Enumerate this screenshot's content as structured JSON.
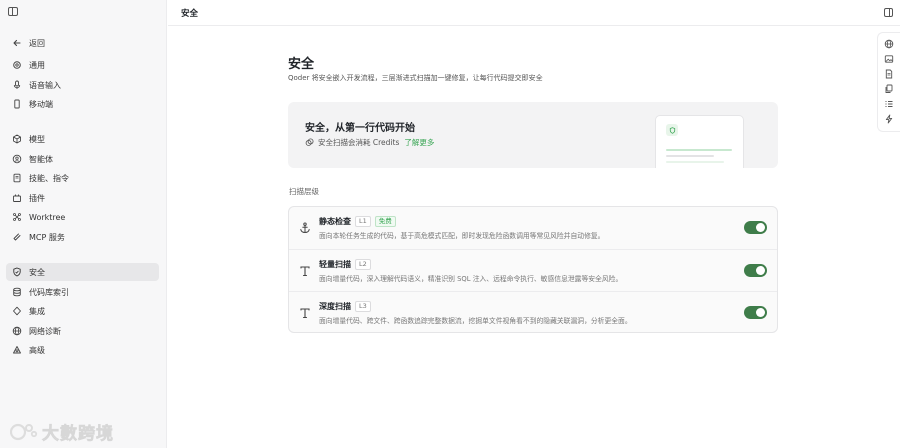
{
  "sidebar": {
    "back": "返回",
    "items": [
      {
        "label": "通用",
        "icon": "gear-icon"
      },
      {
        "label": "语音输入",
        "icon": "microphone-icon"
      },
      {
        "label": "移动端",
        "icon": "mobile-icon"
      },
      {
        "label": "模型",
        "icon": "cube-icon"
      },
      {
        "label": "智能体",
        "icon": "agent-icon"
      },
      {
        "label": "技能、指令",
        "icon": "book-icon"
      },
      {
        "label": "插件",
        "icon": "plugin-icon"
      },
      {
        "label": "Worktree",
        "icon": "branch-icon"
      },
      {
        "label": "MCP 服务",
        "icon": "mcp-icon"
      },
      {
        "label": "安全",
        "icon": "shield-icon",
        "active": true
      },
      {
        "label": "代码库索引",
        "icon": "database-icon"
      },
      {
        "label": "集成",
        "icon": "integration-icon"
      },
      {
        "label": "网络诊断",
        "icon": "globe-icon"
      },
      {
        "label": "高级",
        "icon": "advanced-icon"
      }
    ]
  },
  "watermark": "大數跨境",
  "topbar": {
    "crumb": "安全"
  },
  "main": {
    "title": "安全",
    "description": "Qoder 将安全嵌入开发流程，三层渐进式扫描加一键修复，让每行代码提交即安全",
    "banner": {
      "title": "安全，从第一行代码开始",
      "subtitle": "安全扫描会消耗 Credits",
      "link": "了解更多"
    },
    "section_label": "扫描层级",
    "levels": [
      {
        "title": "静态检查",
        "level": "L1",
        "badge": "免费",
        "desc": "面向本轮任务生成的代码，基于高危模式匹配，即时发现危险函数调用等常见风险并自动修复。",
        "enabled": true,
        "icon": "anchor-icon"
      },
      {
        "title": "轻量扫描",
        "level": "L2",
        "desc": "面向增量代码，深入理解代码语义，精准识别 SQL 注入、远程命令执行、敏感信息泄露等安全风险。",
        "enabled": true,
        "icon": "text-scan-icon"
      },
      {
        "title": "深度扫描",
        "level": "L3",
        "desc": "面向增量代码、跨文件、跨函数追踪完整数据流，挖掘单文件视角看不到的隐藏关联漏洞，分析更全面。",
        "enabled": true,
        "icon": "text-scan-icon"
      }
    ]
  },
  "colors": {
    "accent": "#3aa655",
    "toggle_on": "#3f7d4a"
  }
}
